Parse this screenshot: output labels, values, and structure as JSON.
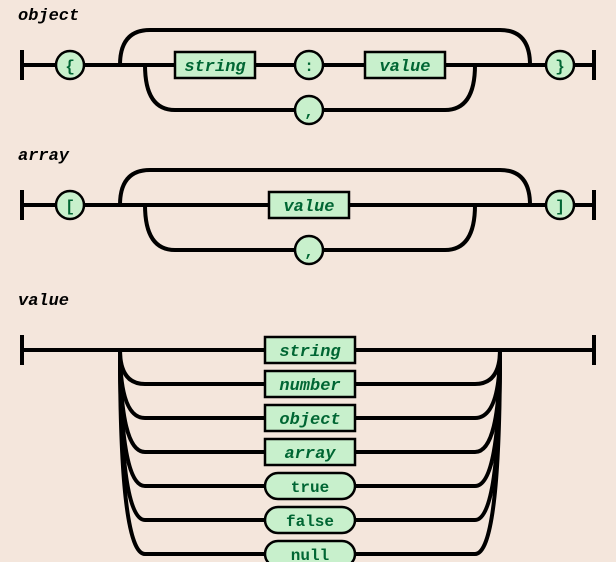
{
  "diagrams": {
    "object": {
      "title": "object",
      "openTerminal": "{",
      "closeTerminal": "}",
      "nonterminals": {
        "string": "string",
        "value": "value"
      },
      "terminals": {
        "colon": ":",
        "comma": ","
      }
    },
    "array": {
      "title": "array",
      "openTerminal": "[",
      "closeTerminal": "]",
      "nonterminals": {
        "value": "value"
      },
      "terminals": {
        "comma": ","
      }
    },
    "value": {
      "title": "value",
      "alternatives": [
        "string",
        "number",
        "object",
        "array",
        "true",
        "false",
        "null"
      ],
      "altKinds": [
        "nonterminal",
        "nonterminal",
        "nonterminal",
        "nonterminal",
        "terminal",
        "terminal",
        "terminal"
      ]
    }
  },
  "style": {
    "bg": "#f4e6dc",
    "rail": "#000000",
    "fill": "#c8f0cc",
    "text": "#006633"
  }
}
